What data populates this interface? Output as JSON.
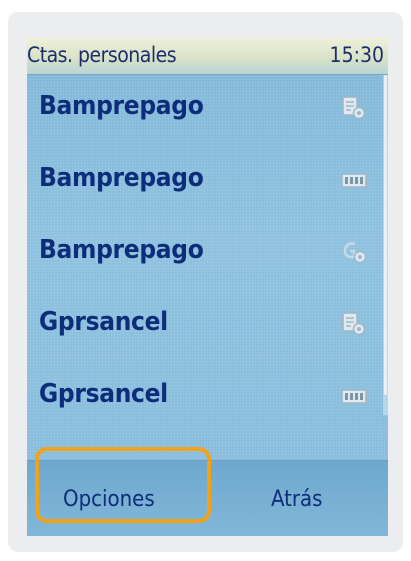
{
  "status_bar": {
    "title": "Ctas. personales",
    "time": "15:30"
  },
  "accounts": [
    {
      "label": "Bamprepago",
      "icon": "document-settings-icon"
    },
    {
      "label": "Bamprepago",
      "icon": "film-strip-icon"
    },
    {
      "label": "Bamprepago",
      "icon": "gprs-settings-icon"
    },
    {
      "label": "Gprsancel",
      "icon": "document-settings-icon"
    },
    {
      "label": "Gprsancel",
      "icon": "film-strip-icon"
    }
  ],
  "softkeys": {
    "left": "Opciones",
    "right": "Atrás"
  },
  "colors": {
    "screen_background": "#86bbdc",
    "text": "#0d2d7a",
    "highlight": "#f0a21a"
  }
}
